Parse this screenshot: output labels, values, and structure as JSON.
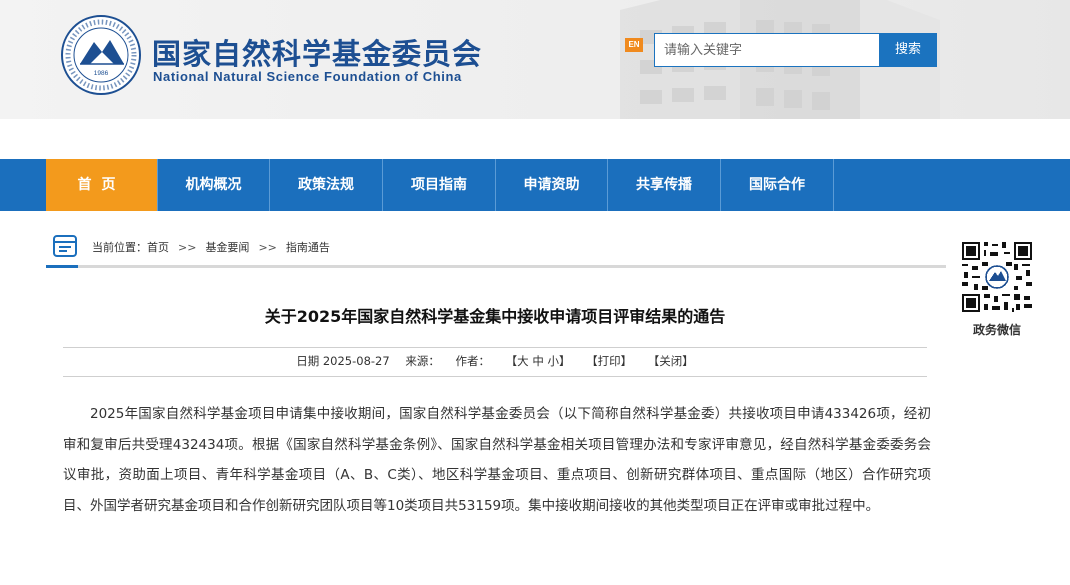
{
  "header": {
    "logo_cn": "国家自然科学基金委员会",
    "logo_en": "National Natural Science Foundation of China",
    "seal_year": "1986",
    "en_badge": "EN",
    "search_placeholder": "请输入关键字",
    "search_button": "搜索"
  },
  "nav": {
    "items": [
      {
        "label": "首页",
        "active": true
      },
      {
        "label": "机构概况"
      },
      {
        "label": "政策法规"
      },
      {
        "label": "项目指南"
      },
      {
        "label": "申请资助"
      },
      {
        "label": "共享传播"
      },
      {
        "label": "国际合作"
      }
    ]
  },
  "breadcrumb": {
    "prefix": "当前位置：",
    "items": [
      "首页",
      "基金要闻",
      "指南通告"
    ],
    "separator": ">>"
  },
  "qr": {
    "label": "政务微信"
  },
  "article": {
    "title": "关于2025年国家自然科学基金集中接收申请项目评审结果的通告",
    "meta": {
      "date": "日期 2025-08-27",
      "source": "来源：",
      "author": "作者：",
      "font_size": "【大 中 小】",
      "print": "【打印】",
      "close": "【关闭】"
    },
    "paragraph": "2025年国家自然科学基金项目申请集中接收期间，国家自然科学基金委员会（以下简称自然科学基金委）共接收项目申请433426项，经初审和复审后共受理432434项。根据《国家自然科学基金条例》、国家自然科学基金相关项目管理办法和专家评审意见，经自然科学基金委委务会议审批，资助面上项目、青年科学基金项目（A、B、C类）、地区科学基金项目、重点项目、创新研究群体项目、重点国际（地区）合作研究项目、外国学者研究基金项目和合作创新研究团队项目等10类项目共53159项。集中接收期间接收的其他类型项目正在评审或审批过程中。"
  },
  "colors": {
    "primary": "#1b6fbd",
    "accent": "#f39a1c",
    "logo_text": "#1d4f92"
  }
}
